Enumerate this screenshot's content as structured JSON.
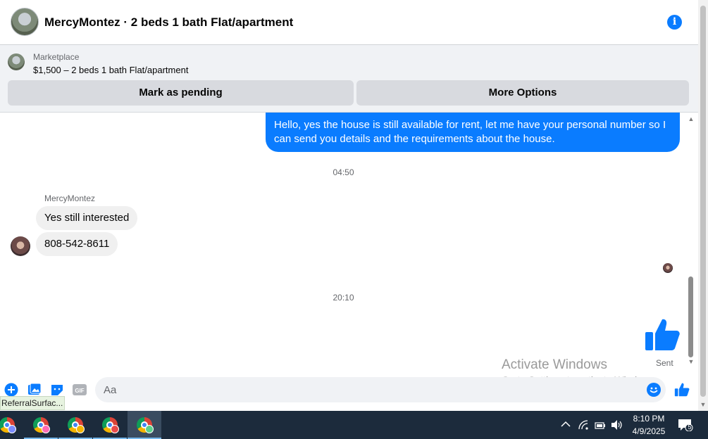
{
  "header": {
    "title": "MercyMontez · 2 beds 1 bath Flat/apartment",
    "info_icon": "i"
  },
  "marketplace": {
    "label": "Marketplace",
    "listing": "$1,500 – 2 beds 1 bath Flat/apartment",
    "mark_pending_label": "Mark as pending",
    "more_options_label": "More Options"
  },
  "messages": {
    "outgoing_text": "Hello, yes the house is still available for rent, let me have your personal number so I can send you details and the requirements about the house.",
    "timestamp_1": "04:50",
    "sender_name": "MercyMontez",
    "incoming_1": "Yes still interested",
    "incoming_2": "808-542-8611",
    "timestamp_2": "20:10",
    "sent_status": "Sent"
  },
  "watermark": {
    "line1": "Activate Windows",
    "line2": "Go to Settings to activate Windows."
  },
  "composer": {
    "placeholder": "Aa",
    "tooltip": "ReferralSurfac..."
  },
  "taskbar": {
    "time": "8:10 PM",
    "date": "4/9/2025",
    "notification_count": "5",
    "apps": [
      {
        "name": "chrome-profile-1",
        "badge_color": "#7b8cff"
      },
      {
        "name": "chrome-profile-2",
        "badge_color": "#ff6bb5"
      },
      {
        "name": "chrome-profile-3",
        "badge_color": "#f4b400"
      },
      {
        "name": "chrome-profile-4",
        "badge_color": "#e94b4b"
      },
      {
        "name": "chrome-profile-5",
        "badge_color": "#5bd08a"
      }
    ]
  },
  "colors": {
    "accent": "#0a7cff",
    "taskbar": "#1c2b3c"
  }
}
